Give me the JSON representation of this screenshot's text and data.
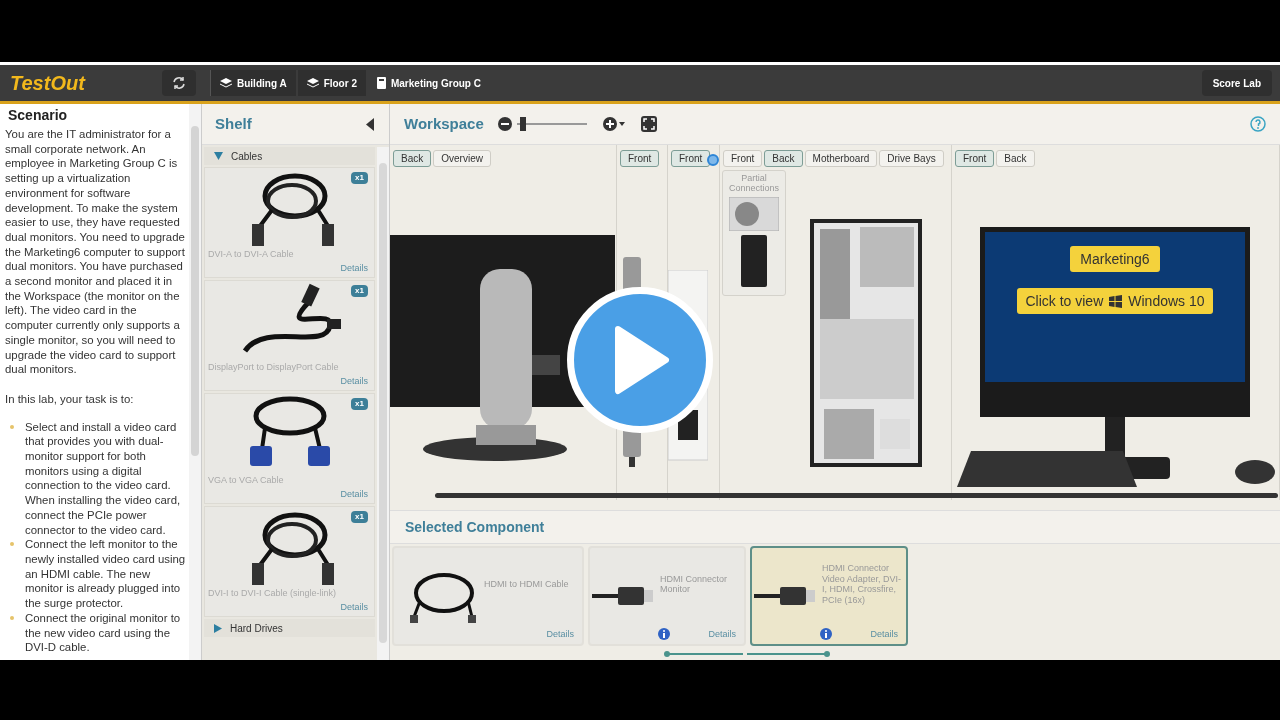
{
  "header": {
    "logo": "TestOut",
    "breadcrumbs": [
      {
        "label": "Building A",
        "kind": "layers"
      },
      {
        "label": "Floor 2",
        "kind": "layers"
      },
      {
        "label": "Marketing Group C",
        "kind": "computer"
      }
    ],
    "score_button": "Score Lab"
  },
  "scenario": {
    "title": "Scenario",
    "paragraphs": [
      "You are the IT administrator for a small corporate network. An employee in Marketing Group C is setting up a virtualization environment for software development. To make the system easier to use, they have requested dual monitors. You need to upgrade the Marketing6 computer to support dual monitors. You have purchased a second monitor and placed it in the Workspace (the monitor on the left). The video card in the computer currently only supports a single monitor, so you will need to upgrade the video card to support dual monitors.",
      "In this lab, your task is to:"
    ],
    "tasks": [
      "Select and install a video card that provides you with dual-monitor support for both monitors using a digital connection to the video card. When installing the video card, connect the PCIe power connector to the video card.",
      "Connect the left monitor to the newly installed video card using an HDMI cable. The new monitor is already plugged into the surge protector.",
      "Connect the original monitor to the new video card using the DVI-D cable."
    ]
  },
  "shelf": {
    "title": "Shelf",
    "categories": [
      {
        "label": "Cables",
        "expanded": true,
        "items": [
          {
            "label": "DVI-A to DVI-A Cable",
            "count": "x1",
            "details": "Details",
            "kind": "coil"
          },
          {
            "label": "DisplayPort to DisplayPort Cable",
            "count": "x1",
            "details": "Details",
            "kind": "straight"
          },
          {
            "label": "VGA to VGA Cable",
            "count": "x1",
            "details": "Details",
            "kind": "vga"
          },
          {
            "label": "DVI-I to DVI-I Cable (single-link)",
            "count": "x1",
            "details": "Details",
            "kind": "coil"
          }
        ]
      },
      {
        "label": "Hard Drives",
        "expanded": false
      }
    ]
  },
  "workspace": {
    "title": "Workspace",
    "zoom": {
      "level": 0.05
    },
    "views": [
      {
        "kind": "monitor",
        "buttons": [
          {
            "label": "Back",
            "selected": true
          },
          {
            "label": "Overview",
            "selected": false
          }
        ]
      },
      {
        "kind": "surge-protector",
        "buttons": [
          {
            "label": "Front",
            "selected": true
          }
        ]
      },
      {
        "kind": "outlet",
        "buttons": [
          {
            "label": "Front",
            "selected": true
          }
        ]
      },
      {
        "kind": "tower",
        "buttons": [
          {
            "label": "Front",
            "selected": false
          },
          {
            "label": "Back",
            "selected": true
          },
          {
            "label": "Motherboard",
            "selected": false
          },
          {
            "label": "Drive Bays",
            "selected": false
          }
        ],
        "popup": "Partial Connections"
      },
      {
        "kind": "computer",
        "buttons": [
          {
            "label": "Front",
            "selected": true
          },
          {
            "label": "Back",
            "selected": false
          }
        ],
        "computer_button": "Marketing6",
        "view_button": "Click to view",
        "os": "Windows 10"
      }
    ]
  },
  "selected_component": {
    "title": "Selected Component",
    "items": [
      {
        "kind": "cable",
        "label": "HDMI to HDMI Cable",
        "details": "Details",
        "selected": false
      },
      {
        "kind": "connector",
        "label": "HDMI Connector Monitor",
        "details": "Details",
        "selected": false
      },
      {
        "kind": "connector",
        "label": "HDMI Connector Video Adapter, DVI-I, HDMI, Crossfire, PCIe (16x)",
        "details": "Details",
        "selected": true
      }
    ]
  }
}
